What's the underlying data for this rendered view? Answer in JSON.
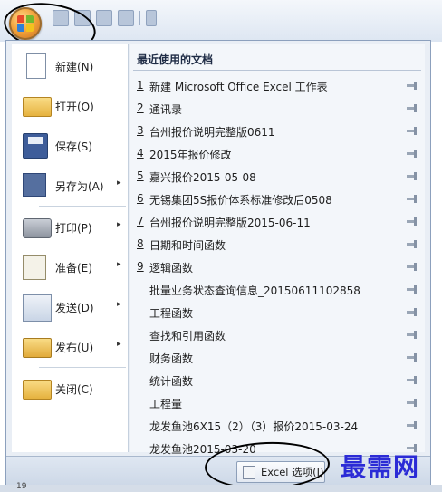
{
  "left_menu": {
    "items": [
      {
        "label": "新建(N)",
        "icon": "new-document-icon",
        "has_submenu": false
      },
      {
        "label": "打开(O)",
        "icon": "open-folder-icon",
        "has_submenu": false
      },
      {
        "label": "保存(S)",
        "icon": "save-disk-icon",
        "has_submenu": false
      },
      {
        "label": "另存为(A)",
        "icon": "save-as-icon",
        "has_submenu": true
      },
      {
        "label": "打印(P)",
        "icon": "printer-icon",
        "has_submenu": true
      },
      {
        "label": "准备(E)",
        "icon": "prepare-icon",
        "has_submenu": true
      },
      {
        "label": "发送(D)",
        "icon": "send-icon",
        "has_submenu": true
      },
      {
        "label": "发布(U)",
        "icon": "publish-icon",
        "has_submenu": true
      },
      {
        "label": "关闭(C)",
        "icon": "close-folder-icon",
        "has_submenu": false
      }
    ],
    "submenu_arrow": "▸"
  },
  "recent": {
    "header": "最近使用的文档",
    "items": [
      {
        "num": "1",
        "name": "新建 Microsoft Office Excel 工作表"
      },
      {
        "num": "2",
        "name": "通讯录"
      },
      {
        "num": "3",
        "name": "台州报价说明完整版0611"
      },
      {
        "num": "4",
        "name": "2015年报价修改"
      },
      {
        "num": "5",
        "name": "嘉兴报价2015-05-08"
      },
      {
        "num": "6",
        "name": "无锡集团5S报价体系标准修改后0508"
      },
      {
        "num": "7",
        "name": "台州报价说明完整版2015-06-11"
      },
      {
        "num": "8",
        "name": "日期和时间函数"
      },
      {
        "num": "9",
        "name": "逻辑函数"
      },
      {
        "num": "",
        "name": "批量业务状态查询信息_20150611102858"
      },
      {
        "num": "",
        "name": "工程函数"
      },
      {
        "num": "",
        "name": "查找和引用函数"
      },
      {
        "num": "",
        "name": "财务函数"
      },
      {
        "num": "",
        "name": "统计函数"
      },
      {
        "num": "",
        "name": "工程量"
      },
      {
        "num": "",
        "name": "龙发鱼池6X15（2）（3）报价2015-03-24"
      },
      {
        "num": "",
        "name": "龙发鱼池2015-03-20"
      }
    ]
  },
  "bottom": {
    "options_label": "Excel 选项(I)"
  },
  "watermark": "最需网",
  "sheet_row": "19"
}
